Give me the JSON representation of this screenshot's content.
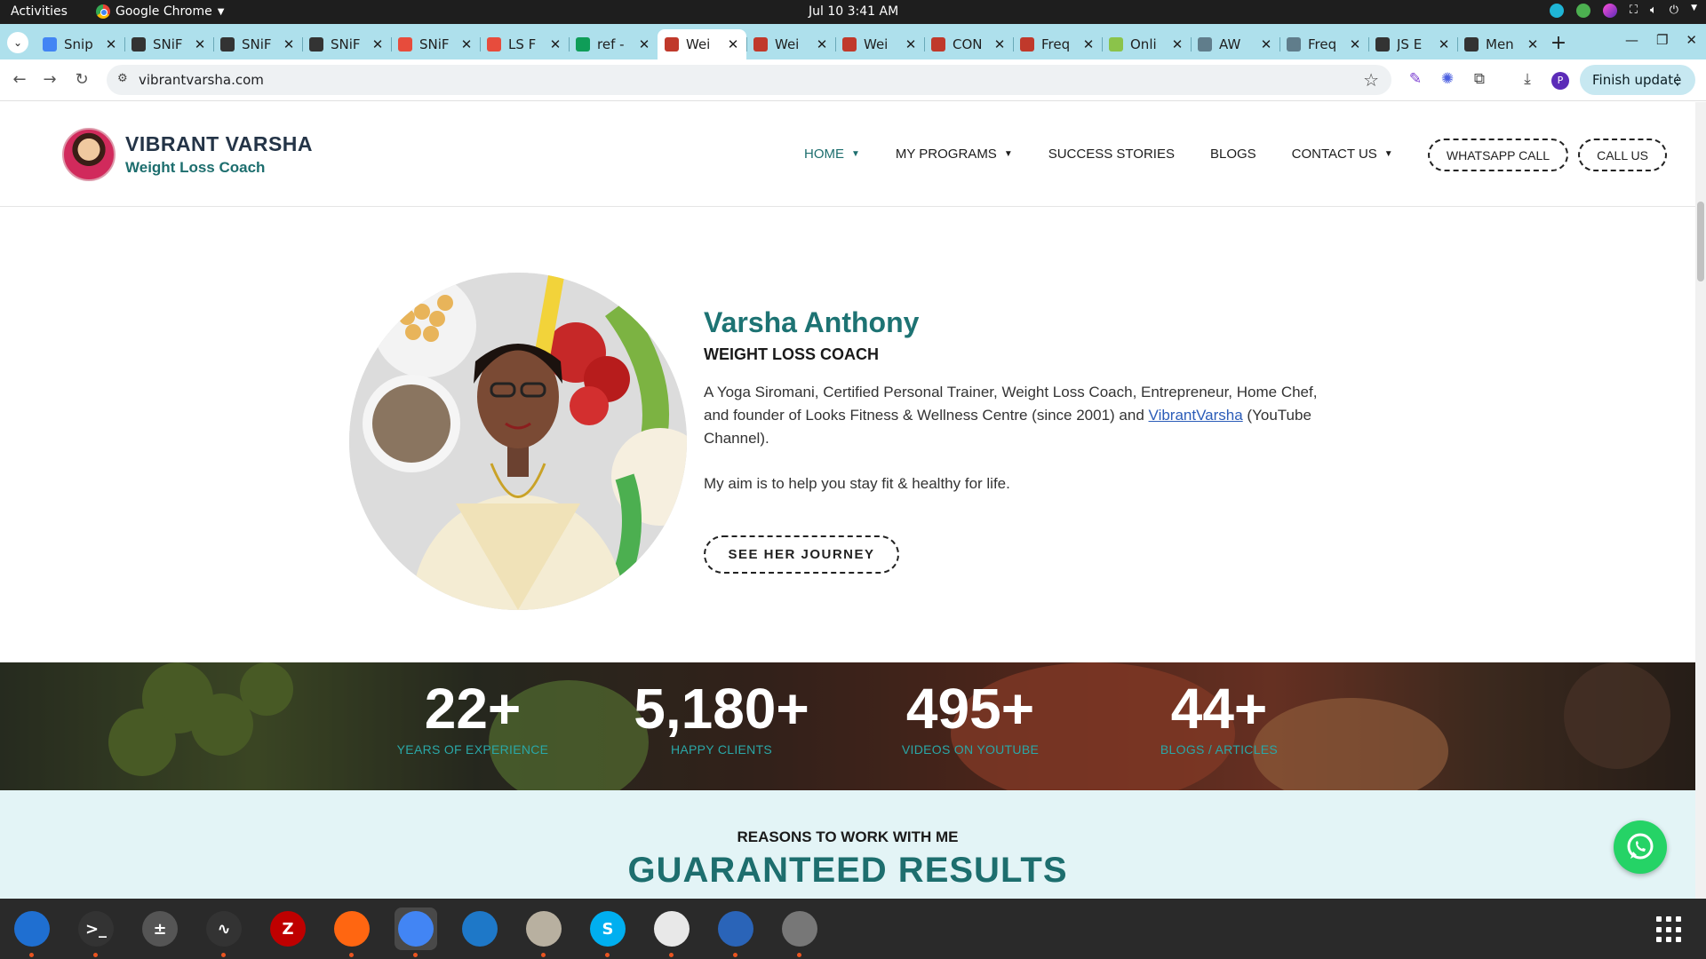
{
  "system": {
    "activities": "Activities",
    "app_name": "Google Chrome",
    "clock": "Jul 10  3:41 AM"
  },
  "tabs": [
    {
      "label": "Snip",
      "icon": "docs-icon",
      "color": "#4285f4"
    },
    {
      "label": "SNiF",
      "icon": "snippet-icon",
      "color": "#333333"
    },
    {
      "label": "SNiF",
      "icon": "snippet-icon",
      "color": "#333333"
    },
    {
      "label": "SNiF",
      "icon": "snippet-icon",
      "color": "#333333"
    },
    {
      "label": "SNiF",
      "icon": "snippet-icon",
      "color": "#e74c3c"
    },
    {
      "label": "LS F",
      "icon": "ls-icon",
      "color": "#e74c3c"
    },
    {
      "label": "ref -",
      "icon": "sheets-icon",
      "color": "#0f9d58"
    },
    {
      "label": "Wei",
      "icon": "vv-icon",
      "color": "#c0392b",
      "active": true
    },
    {
      "label": "Wei",
      "icon": "vv-icon",
      "color": "#c0392b"
    },
    {
      "label": "Wei",
      "icon": "vv-icon",
      "color": "#c0392b"
    },
    {
      "label": "CON",
      "icon": "vv-icon",
      "color": "#c0392b"
    },
    {
      "label": "Freq",
      "icon": "vv-icon",
      "color": "#c0392b"
    },
    {
      "label": "Onli",
      "icon": "image-icon",
      "color": "#8bc34a"
    },
    {
      "label": "AW",
      "icon": "aw-icon",
      "color": "#607d8b"
    },
    {
      "label": "Freq",
      "icon": "aw-icon",
      "color": "#607d8b"
    },
    {
      "label": "JS E",
      "icon": "shield-icon",
      "color": "#333333"
    },
    {
      "label": "Men",
      "icon": "shield-icon",
      "color": "#333333"
    }
  ],
  "browser": {
    "url": "vibrantvarsha.com",
    "finish_update": "Finish update",
    "profile_initial": "P"
  },
  "site": {
    "brand_title": "VIBRANT VARSHA",
    "brand_sub": "Weight Loss Coach",
    "nav": [
      {
        "label": "HOME",
        "caret": true,
        "active": true
      },
      {
        "label": "MY PROGRAMS",
        "caret": true
      },
      {
        "label": "SUCCESS STORIES",
        "caret": false
      },
      {
        "label": "BLOGS",
        "caret": false
      },
      {
        "label": "CONTACT US",
        "caret": true
      }
    ],
    "whatsapp_call": "WHATSAPP CALL",
    "call_us": "CALL US"
  },
  "hero": {
    "name": "Varsha Anthony",
    "role": "WEIGHT LOSS COACH",
    "desc_before": "A Yoga Siromani, Certified Personal Trainer, Weight Loss Coach, Entrepreneur, Home Chef, and founder of Looks Fitness & Wellness Centre (since 2001) and ",
    "desc_link": "VibrantVarsha",
    "desc_after": " (YouTube Channel).",
    "aim": "My aim is to help you stay fit & healthy for life.",
    "cta": "SEE HER JOURNEY"
  },
  "stats": [
    {
      "value": "22+",
      "label": "YEARS OF EXPERIENCE"
    },
    {
      "value": "5,180+",
      "label": "HAPPY CLIENTS"
    },
    {
      "value": "495+",
      "label": "VIDEOS ON YOUTUBE"
    },
    {
      "value": "44+",
      "label": "BLOGS / ARTICLES"
    }
  ],
  "reasons": {
    "kicker": "REASONS TO WORK WITH ME",
    "title": "GUARANTEED RESULTS"
  },
  "dock": [
    {
      "name": "thunderbird-icon",
      "color": "#1f6fd1",
      "running": true
    },
    {
      "name": "terminal-icon",
      "color": "#333333",
      "glyph": ">_",
      "running": true
    },
    {
      "name": "calculator-icon",
      "color": "#555555",
      "glyph": "±",
      "running": false
    },
    {
      "name": "system-monitor-icon",
      "color": "#333333",
      "glyph": "∿",
      "running": true
    },
    {
      "name": "filezilla-icon",
      "color": "#bf0000",
      "glyph": "Z",
      "running": false
    },
    {
      "name": "firefox-icon",
      "color": "#ff6611",
      "running": true
    },
    {
      "name": "chrome-icon",
      "color": "#4285f4",
      "running": true,
      "focused": true
    },
    {
      "name": "vscode-icon",
      "color": "#1e78c8",
      "running": false
    },
    {
      "name": "files-icon",
      "color": "#b8b0a0",
      "running": true
    },
    {
      "name": "skype-icon",
      "color": "#00aff0",
      "glyph": "S",
      "running": true
    },
    {
      "name": "text-editor-icon",
      "color": "#e8e8e8",
      "running": true
    },
    {
      "name": "writer-icon",
      "color": "#2a64b8",
      "running": true
    },
    {
      "name": "disk-icon",
      "color": "#777777",
      "running": true
    }
  ]
}
